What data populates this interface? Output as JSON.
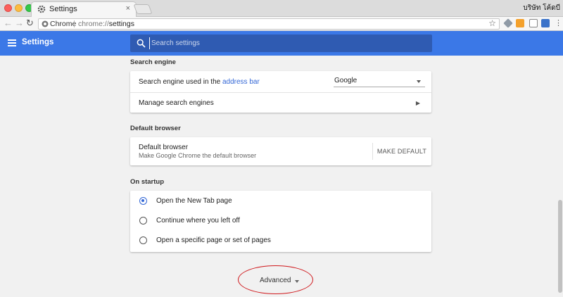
{
  "browser": {
    "tab_title": "Settings",
    "tab_close": "×",
    "profile_name": "บริษัท โค้ดบี",
    "omnibox_chip": "Chrome",
    "url_scheme": "chrome://",
    "url_path": "settings"
  },
  "header": {
    "title": "Settings",
    "search_placeholder": "Search settings"
  },
  "search_engine": {
    "section_title": "Search engine",
    "label_prefix": "Search engine used in the ",
    "label_link": "address bar",
    "selected": "Google",
    "manage_label": "Manage search engines"
  },
  "default_browser": {
    "section_title": "Default browser",
    "title": "Default browser",
    "subtitle": "Make Google Chrome the default browser",
    "button_label": "MAKE DEFAULT"
  },
  "on_startup": {
    "section_title": "On startup",
    "options": [
      {
        "label": "Open the New Tab page",
        "checked": true
      },
      {
        "label": "Continue where you left off",
        "checked": false
      },
      {
        "label": "Open a specific page or set of pages",
        "checked": false
      }
    ]
  },
  "advanced": {
    "label": "Advanced"
  },
  "colors": {
    "header_blue": "#3b78e7",
    "search_box": "#2f5bb2",
    "link_blue": "#3367d6",
    "annotation_red": "#d0191d"
  }
}
